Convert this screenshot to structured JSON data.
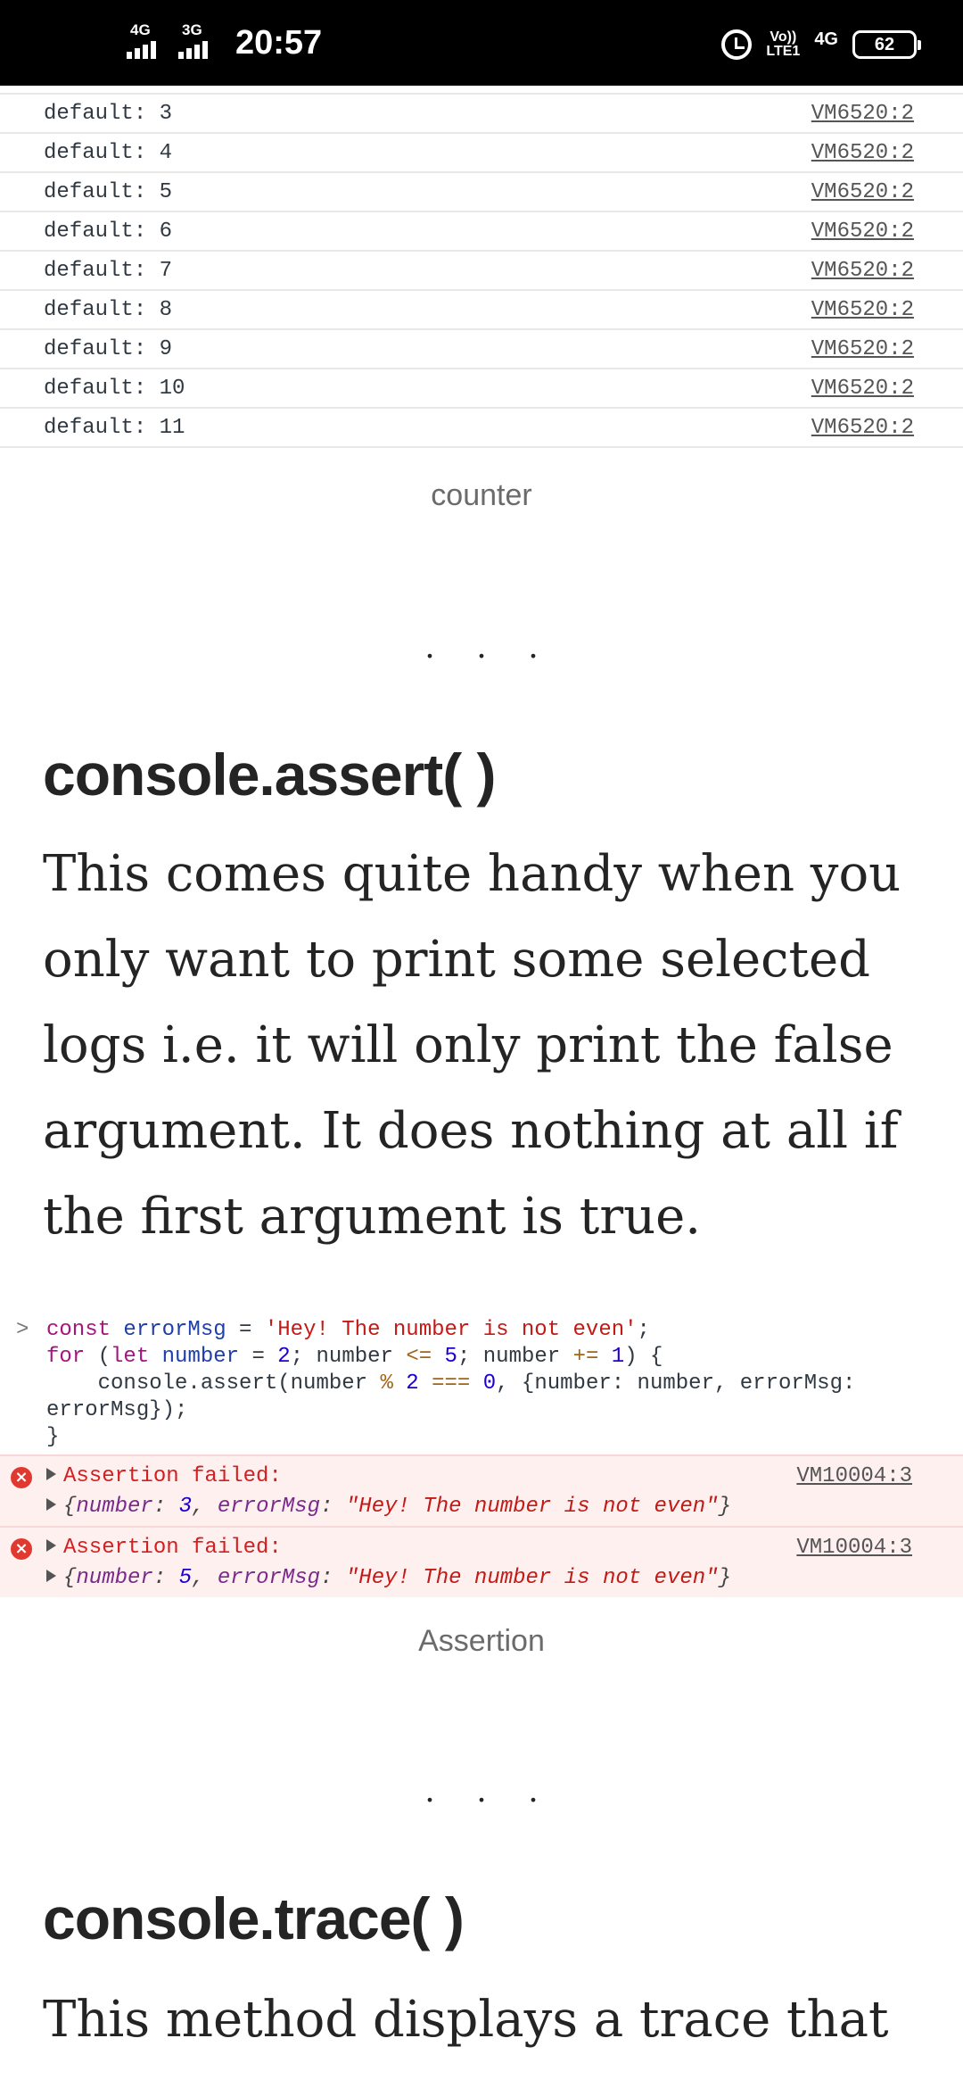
{
  "status_bar": {
    "net1": "4G",
    "net2": "3G",
    "time": "20:57",
    "volte_top": "Vo))",
    "volte_bottom": "LTE1",
    "net3": "4G",
    "battery": "62"
  },
  "console_rows": [
    {
      "msg": "default: 3",
      "src": "VM6520:2"
    },
    {
      "msg": "default: 4",
      "src": "VM6520:2"
    },
    {
      "msg": "default: 5",
      "src": "VM6520:2"
    },
    {
      "msg": "default: 6",
      "src": "VM6520:2"
    },
    {
      "msg": "default: 7",
      "src": "VM6520:2"
    },
    {
      "msg": "default: 8",
      "src": "VM6520:2"
    },
    {
      "msg": "default: 9",
      "src": "VM6520:2"
    },
    {
      "msg": "default: 10",
      "src": "VM6520:2"
    },
    {
      "msg": "default: 11",
      "src": "VM6520:2"
    }
  ],
  "caption1": "counter",
  "dots": "...",
  "section1": {
    "heading": "console.assert( )",
    "paragraph": "This comes quite handy when you only want to print some selected logs i.e. it will only print the false argument. It does nothing at all if the first argument is true."
  },
  "code": {
    "prompt": ">",
    "l1_kw": "const",
    "l1_var": "errorMsg",
    "l1_eq": " = ",
    "l1_str": "'Hey! The number is not even'",
    "l1_end": ";",
    "l2_for": "for",
    "l2_a": " (",
    "l2_let": "let",
    "l2_var": "number",
    "l2_b": " = ",
    "l2_n1": "2",
    "l2_c": "; number ",
    "l2_op1": "<=",
    "l2_n2": "5",
    "l2_d": "; number ",
    "l2_op2": "+=",
    "l2_n3": "1",
    "l2_e": ") {",
    "l3_a": "    console.assert(number ",
    "l3_op1": "%",
    "l3_n1": "2",
    "l3_op2": "===",
    "l3_n2": "0",
    "l3_b": ", {number: number, errorMsg:",
    "l4": "errorMsg});",
    "l5": "}"
  },
  "errors": [
    {
      "title": "Assertion failed:",
      "src": "VM10004:3",
      "k1": "number",
      "v1": "3",
      "k2": "errorMsg",
      "v2": "\"Hey! The number is not even\""
    },
    {
      "title": "Assertion failed:",
      "src": "VM10004:3",
      "k1": "number",
      "v1": "5",
      "k2": "errorMsg",
      "v2": "\"Hey! The number is not even\""
    }
  ],
  "caption2": "Assertion",
  "section2": {
    "heading": "console.trace( )",
    "paragraph": "This method displays a trace that"
  }
}
